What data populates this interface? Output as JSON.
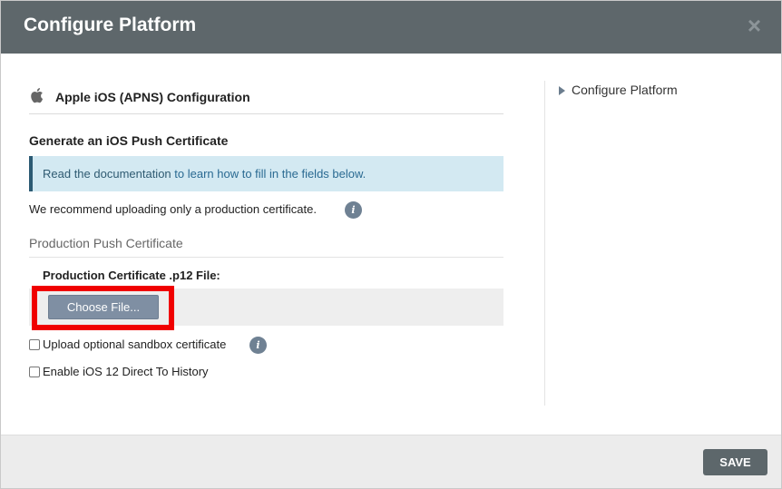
{
  "dialog": {
    "title": "Configure Platform",
    "close_label": "×"
  },
  "main": {
    "section_title": "Apple iOS (APNS) Configuration",
    "section_icon": "apple-icon",
    "sub_heading": "Generate an iOS Push Certificate",
    "info": {
      "prefix": "Read the documentation",
      "link_text": " to learn how to fill in the fields below."
    },
    "recommend_text": "We recommend uploading only a production certificate.",
    "info_icon_glyph": "i",
    "production_push_label": "Production Push Certificate",
    "cert_file_label": "Production Certificate .p12 File:",
    "choose_file_label": "Choose File...",
    "checkboxes": [
      {
        "label": "Upload optional sandbox certificate",
        "checked": false
      },
      {
        "label": "Enable iOS 12 Direct To History",
        "checked": false
      }
    ]
  },
  "side_nav": {
    "items": [
      {
        "label": "Configure Platform"
      }
    ]
  },
  "footer": {
    "save_label": "SAVE"
  },
  "colors": {
    "header_bg": "#5e676b",
    "info_bg": "#d3e9f2",
    "info_border": "#2c5a73",
    "button_bg": "#7f8fa3",
    "highlight": "#f00000",
    "save_bg": "#5d676b"
  }
}
